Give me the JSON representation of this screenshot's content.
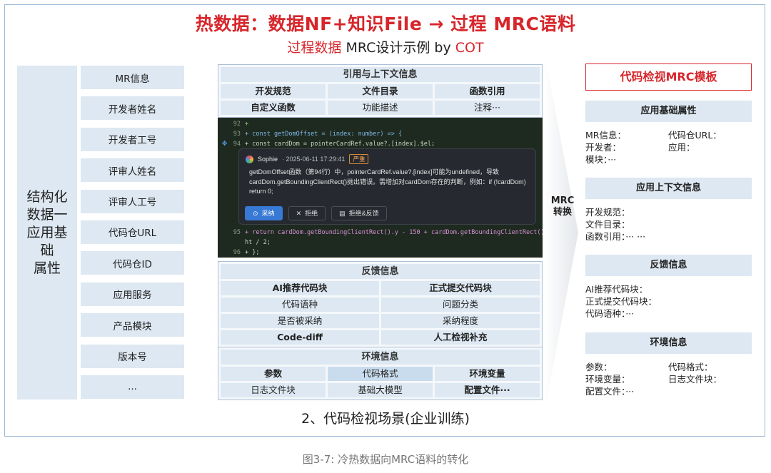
{
  "title": "热数据：数据NF+知识File → 过程 MRC语料",
  "subtitle": {
    "red1": "过程数据",
    "mid": " MRC设计示例  by ",
    "red2": "COT"
  },
  "left_band": "结构化\n数据一\n应用基础\n属性",
  "attributes": [
    "MR信息",
    "开发者姓名",
    "开发者工号",
    "评审人姓名",
    "评审人工号",
    "代码仓URL",
    "代码仓ID",
    "应用服务",
    "产品模块",
    "版本号",
    "..."
  ],
  "ref_table": {
    "head": "引用与上下文信息",
    "rows": [
      [
        "开发规范",
        "文件目录",
        "函数引用"
      ],
      [
        "自定义函数",
        "功能描述",
        "注释···"
      ]
    ]
  },
  "code": {
    "lines": [
      {
        "num": "92",
        "text": "+"
      },
      {
        "num": "93",
        "text": "+ const getDomOffset = (index: number) => {"
      },
      {
        "num": "94",
        "text": "+   const cardDom = pointerCardRef.value?.[index].$el;"
      },
      {
        "num": "95",
        "text": "+   return cardDom.getBoundingClientRect().y - 150 + cardDom.getBoundingClientRect().heig"
      },
      {
        "num": "",
        "text": "ht / 2;"
      },
      {
        "num": "96",
        "text": "+ };"
      }
    ],
    "comment": {
      "user": "Sophie",
      "time": "· 2025-06-11 17:29:41",
      "tag": "严重",
      "message": "getDomOffset函数（第94行）中，pointerCardRef.value?.[index]可能为undefined，导致cardDom.getBoundingClientRect()抛出错误。需增加对cardDom存在的判断，例如：if (!cardDom) return 0;",
      "buttons": [
        "采纳",
        "拒绝",
        "拒绝&反馈"
      ]
    }
  },
  "feedback_table": {
    "head": "反馈信息",
    "rows": [
      [
        "AI推荐代码块",
        "正式提交代码块"
      ],
      [
        "代码语种",
        "问题分类"
      ],
      [
        "是否被采纳",
        "采纳程度"
      ],
      [
        "Code-diff",
        "人工检视补充"
      ]
    ]
  },
  "env_table": {
    "head": "环境信息",
    "rows": [
      [
        "参数",
        "代码格式",
        "环境变量"
      ],
      [
        "日志文件块",
        "基础大模型",
        "配置文件···"
      ]
    ]
  },
  "mrc_label": "MRC\n转换",
  "template": {
    "title": "代码检视MRC模板",
    "sections": [
      {
        "head": "应用基础属性",
        "lines": [
          [
            "MR信息：",
            "代码仓URL："
          ],
          [
            "开发者：",
            "应用："
          ],
          [
            "模块：···",
            ""
          ]
        ]
      },
      {
        "head": "应用上下文信息",
        "lines": [
          [
            "开发规范：",
            ""
          ],
          [
            "文件目录：",
            ""
          ],
          [
            "函数引用：··· ···",
            ""
          ]
        ]
      },
      {
        "head": "反馈信息",
        "lines": [
          [
            "AI推荐代码块：",
            ""
          ],
          [
            "正式提交代码块：",
            ""
          ],
          [
            "代码语种：···",
            ""
          ]
        ]
      },
      {
        "head": "环境信息",
        "lines": [
          [
            "参数：",
            "代码格式："
          ],
          [
            "环境变量：",
            "日志文件块："
          ],
          [
            "配置文件：···",
            ""
          ]
        ]
      }
    ]
  },
  "scene_caption": "2、代码检视场景(企业训练)",
  "figure_caption": "图3-7: 冷热数据向MRC语料的转化",
  "colors": {
    "accent_red": "#d7262b",
    "block_blue": "#dde8f2",
    "border_blue": "#9ab7d3"
  }
}
